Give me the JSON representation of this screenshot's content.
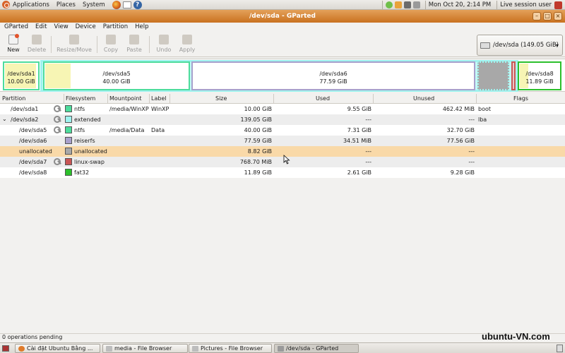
{
  "top_panel": {
    "menus": [
      "Applications",
      "Places",
      "System"
    ],
    "clock": "Mon Oct 20,  2:14 PM",
    "user": "Live session user"
  },
  "window": {
    "title": "/dev/sda - GParted"
  },
  "menubar": [
    "GParted",
    "Edit",
    "View",
    "Device",
    "Partition",
    "Help"
  ],
  "toolbar": {
    "new": "New",
    "delete": "Delete",
    "resize_move": "Resize/Move",
    "copy": "Copy",
    "paste": "Paste",
    "undo": "Undo",
    "apply": "Apply"
  },
  "device_selector": {
    "value": "/dev/sda  (149.05 GiB)"
  },
  "partition_map": {
    "sda1": {
      "name": "/dev/sda1",
      "size": "10.00 GiB",
      "color": "#4ddc9c",
      "used_fraction": 0.955
    },
    "sda5": {
      "name": "/dev/sda5",
      "size": "40.00 GiB",
      "color": "#4ddc9c",
      "used_fraction": 0.18
    },
    "sda6": {
      "name": "/dev/sda6",
      "size": "77.59 GiB",
      "color": "#a8a0cc"
    },
    "sda8": {
      "name": "/dev/sda8",
      "size": "11.89 GiB",
      "color": "#2cc02c",
      "used_fraction": 0.22
    }
  },
  "table": {
    "headers": [
      "Partition",
      "Filesystem",
      "Mountpoint",
      "Label",
      "Size",
      "Used",
      "Unused",
      "Flags"
    ],
    "rows": [
      {
        "partition": "/dev/sda1",
        "fs": "ntfs",
        "fs_color": "#4ddc9c",
        "mount": "/media/WinXP",
        "label": "WinXP",
        "size": "10.00 GiB",
        "used": "9.55 GiB",
        "unused": "462.42 MiB",
        "flags": "boot",
        "locked": true
      },
      {
        "partition": "/dev/sda2",
        "fs": "extended",
        "fs_color": "#9ef2ee",
        "mount": "",
        "label": "",
        "size": "139.05 GiB",
        "used": "---",
        "unused": "---",
        "flags": "lba",
        "locked": true,
        "expander": "⌄"
      },
      {
        "partition": "/dev/sda5",
        "fs": "ntfs",
        "fs_color": "#4ddc9c",
        "mount": "/media/Data",
        "label": "Data",
        "size": "40.00 GiB",
        "used": "7.31 GiB",
        "unused": "32.70 GiB",
        "flags": "",
        "locked": true
      },
      {
        "partition": "/dev/sda6",
        "fs": "reiserfs",
        "fs_color": "#a8a0cc",
        "mount": "",
        "label": "",
        "size": "77.59 GiB",
        "used": "34.51 MiB",
        "unused": "77.56 GiB",
        "flags": "",
        "locked": false
      },
      {
        "partition": "unallocated",
        "fs": "unallocated",
        "fs_color": "#a8a8a8",
        "mount": "",
        "label": "",
        "size": "8.82 GiB",
        "used": "---",
        "unused": "---",
        "flags": "",
        "locked": false
      },
      {
        "partition": "/dev/sda7",
        "fs": "linux-swap",
        "fs_color": "#c95555",
        "mount": "",
        "label": "",
        "size": "768.70 MiB",
        "used": "---",
        "unused": "---",
        "flags": "",
        "locked": true
      },
      {
        "partition": "/dev/sda8",
        "fs": "fat32",
        "fs_color": "#2cc02c",
        "mount": "",
        "label": "",
        "size": "11.89 GiB",
        "used": "2.61 GiB",
        "unused": "9.28 GiB",
        "flags": "",
        "locked": false
      }
    ]
  },
  "status": {
    "pending": "0 operations pending",
    "watermark": "ubuntu-VN.com"
  },
  "taskbar": [
    "Cài đặt Ubuntu Bằng ...",
    "media - File Browser",
    "Pictures - File Browser",
    "/dev/sda - GParted"
  ]
}
